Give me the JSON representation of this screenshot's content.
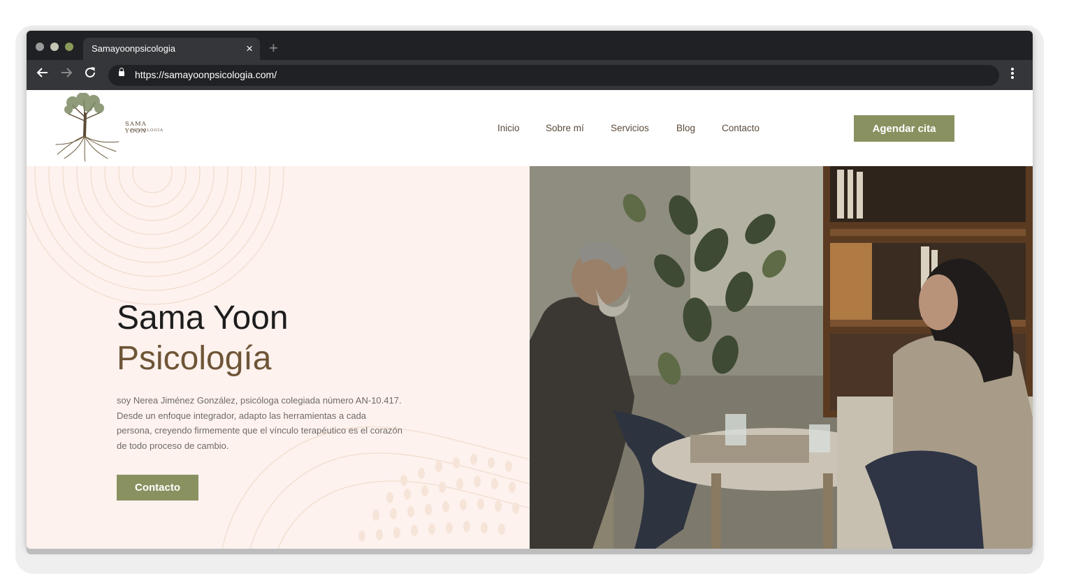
{
  "browser": {
    "tab_title": "Samayoonpsicologia",
    "close_glyph": "×",
    "new_tab_glyph": "+",
    "url": "https://samayoonpsicologia.com/",
    "icons": [
      "back-arrow-icon",
      "forward-arrow-icon",
      "reload-icon",
      "lock-icon",
      "kebab-menu-icon"
    ]
  },
  "site": {
    "logo": {
      "name": "SAMA YOON",
      "sub": "PSICOLOGÍA"
    },
    "nav": [
      "Inicio",
      "Sobre mí",
      "Servicios",
      "Blog",
      "Contacto"
    ],
    "cta": "Agendar cita",
    "hero": {
      "title_line1": "Sama Yoon",
      "title_line2": "Psicología",
      "bio": "soy Nerea Jiménez González, psicóloga colegiada número AN-10.417. Desde un enfoque integrador, adapto las herramientas a cada persona, creyendo firmemente que el vínculo terapéutico es el corazón de todo proceso de cambio.",
      "button": "Contacto"
    }
  },
  "colors": {
    "accent": "#8a9160",
    "brown": "#6e5536",
    "hero_bg": "#fdf2ee",
    "browser_dark": "#202124"
  }
}
